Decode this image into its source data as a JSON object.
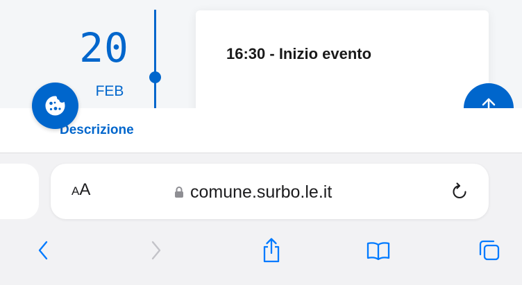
{
  "event": {
    "day": "20",
    "month": "FEB",
    "title": "16:30 - Inizio evento",
    "tab_label": "Descrizione"
  },
  "icons": {
    "cookie": "cookie-icon",
    "scroll_top": "arrow-up-icon",
    "text_size": "aa-icon",
    "lock": "lock-icon",
    "reload": "reload-icon",
    "back": "chevron-left-icon",
    "forward": "chevron-right-icon",
    "share": "share-icon",
    "bookmarks": "book-icon",
    "tabs": "tabs-icon"
  },
  "browser": {
    "text_size_small": "A",
    "text_size_large": "A",
    "url": "comune.surbo.le.it"
  },
  "colors": {
    "accent": "#0066cc",
    "ios_blue": "#007aff",
    "disabled": "#c3c3c8"
  }
}
